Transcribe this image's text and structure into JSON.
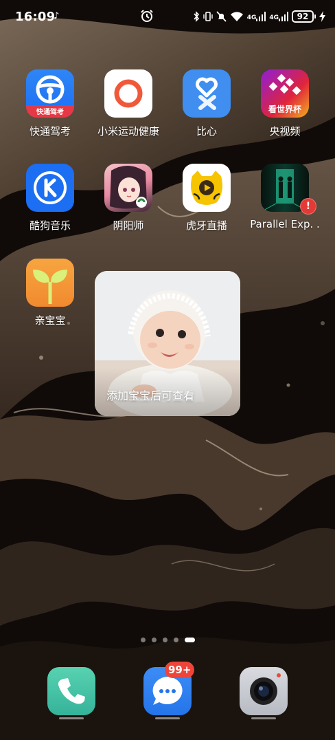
{
  "status_bar": {
    "time": "16:09",
    "network_1": "4G",
    "network_2": "4G",
    "battery": "92",
    "icons": [
      "tiktok-icon",
      "alarm-icon",
      "bluetooth-icon",
      "vibrate-icon",
      "mute-icon",
      "wifi-icon",
      "signal-icon",
      "charging-icon"
    ]
  },
  "apps": [
    {
      "label": "快通驾考",
      "badge": "快通驾考",
      "icon": "steering-wheel-icon"
    },
    {
      "label": "小米运动健康",
      "icon": "ring-icon"
    },
    {
      "label": "比心",
      "icon": "heart-icon"
    },
    {
      "label": "央视频",
      "badge": "看世界杯",
      "icon": "cctv-icon"
    },
    {
      "label": "酷狗音乐",
      "icon": "kugou-k-icon"
    },
    {
      "label": "阴阳师",
      "icon": "onmyoji-character-icon"
    },
    {
      "label": "虎牙直播",
      "icon": "huya-tiger-icon"
    },
    {
      "label": "Parallel Exp. .",
      "icon": "parallel-exp-icon",
      "notification": "!"
    },
    {
      "label": "亲宝宝",
      "icon": "sprout-icon"
    }
  ],
  "widget": {
    "text": "添加宝宝后可查看"
  },
  "pages": {
    "count": 5,
    "active": 4
  },
  "dock": {
    "items": [
      {
        "name": "phone",
        "icon": "phone-icon"
      },
      {
        "name": "messages",
        "icon": "message-bubble-icon",
        "badge": "99+"
      },
      {
        "name": "camera",
        "icon": "camera-icon"
      }
    ]
  },
  "colors": {
    "alert_red": "#e53935",
    "kugou_blue": "#1c6ef2",
    "mi_orange": "#f0583a",
    "bixin_blue": "#3f8ef0"
  }
}
